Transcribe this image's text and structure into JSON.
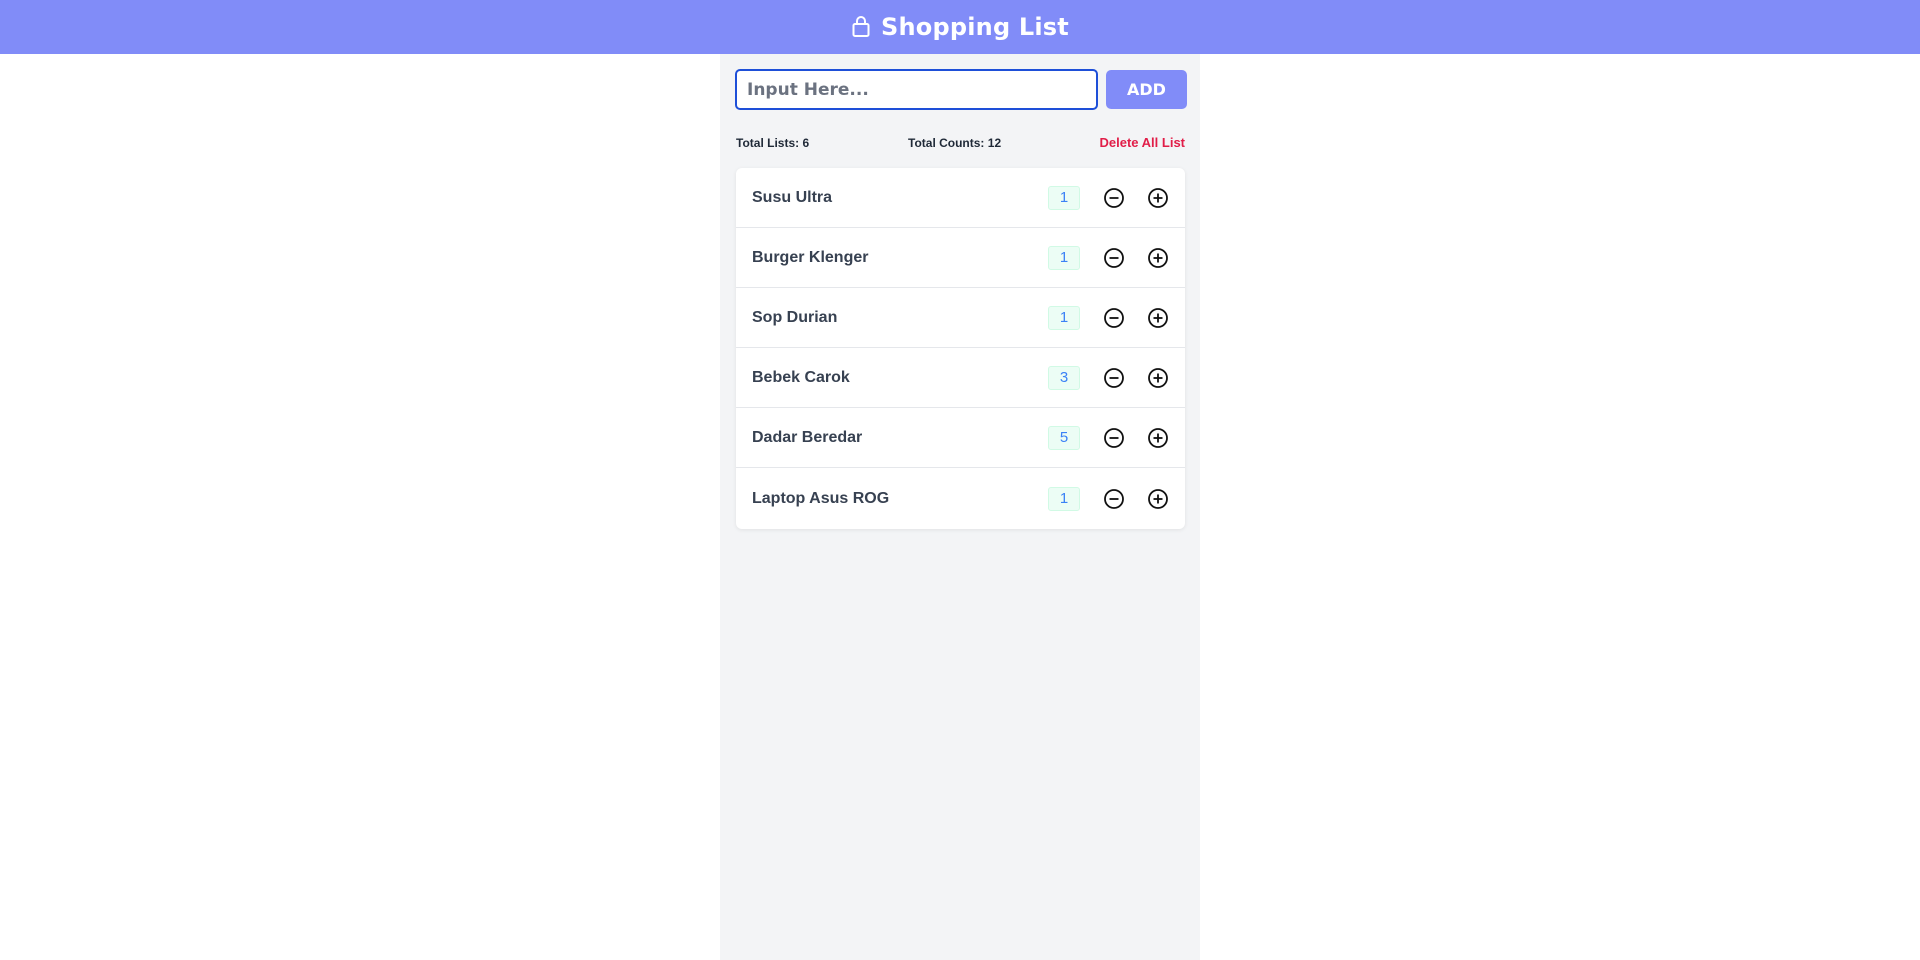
{
  "header": {
    "title": "Shopping List",
    "icon": "shopping-bag-icon"
  },
  "form": {
    "input_placeholder": "Input Here...",
    "input_value": "",
    "add_label": "ADD"
  },
  "stats": {
    "total_lists": "Total Lists: 6",
    "total_counts": "Total Counts: 12",
    "delete_all_label": "Delete All List"
  },
  "items": [
    {
      "name": "Susu Ultra",
      "count": "1"
    },
    {
      "name": "Burger Klenger",
      "count": "1"
    },
    {
      "name": "Sop Durian",
      "count": "1"
    },
    {
      "name": "Bebek Carok",
      "count": "3"
    },
    {
      "name": "Dadar Beredar",
      "count": "5"
    },
    {
      "name": "Laptop Asus ROG",
      "count": "1"
    }
  ],
  "colors": {
    "header_bg": "#818cf8",
    "panel_bg": "#f3f4f6",
    "delete_text": "#e11d48",
    "count_text": "#3b82f6"
  }
}
